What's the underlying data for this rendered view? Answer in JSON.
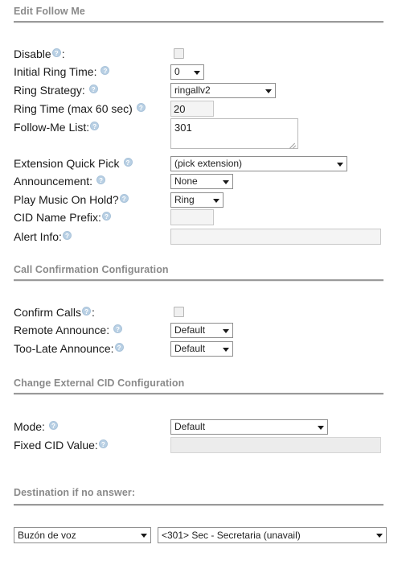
{
  "page": {
    "title": "Edit Follow Me"
  },
  "sections": {
    "main_heading": "Edit Follow Me",
    "call_confirmation": "Call Confirmation Configuration",
    "change_external_cid": "Change External CID Configuration",
    "destination": "Destination if no answer:"
  },
  "help_icon": {
    "name": "help-icon",
    "glyph": "?",
    "color": "#b9d0e4"
  },
  "fields": {
    "disable": {
      "label": "Disable",
      "suffix": ":",
      "checked": false,
      "control": "checkbox"
    },
    "initial_ring_time": {
      "label": "Initial Ring Time:",
      "value": "0",
      "control": "select"
    },
    "ring_strategy": {
      "label": "Ring Strategy:",
      "value": "ringallv2",
      "control": "select"
    },
    "ring_time": {
      "label": "Ring Time (max 60 sec)",
      "value": "20",
      "control": "text"
    },
    "follow_me_list": {
      "label": "Follow-Me List:",
      "value": "301",
      "control": "textarea"
    },
    "extension_quick_pick": {
      "label": "Extension Quick Pick",
      "value": "(pick extension)",
      "control": "select"
    },
    "announcement": {
      "label": "Announcement:",
      "value": "None",
      "control": "select"
    },
    "play_music_on_hold": {
      "label": "Play Music On Hold?",
      "value": "Ring",
      "control": "select"
    },
    "cid_name_prefix": {
      "label": "CID Name Prefix:",
      "value": "",
      "placeholder": "",
      "control": "text"
    },
    "alert_info": {
      "label": "Alert Info:",
      "value": "",
      "placeholder": "",
      "control": "text"
    },
    "confirm_calls": {
      "label": "Confirm Calls",
      "suffix": ":",
      "checked": false,
      "control": "checkbox"
    },
    "remote_announce": {
      "label": "Remote Announce:",
      "value": "Default",
      "control": "select"
    },
    "too_late_announce": {
      "label": "Too-Late Announce:",
      "value": "Default",
      "control": "select"
    },
    "mode": {
      "label": "Mode:",
      "value": "Default",
      "control": "select"
    },
    "fixed_cid_value": {
      "label": "Fixed CID Value:",
      "value": "",
      "placeholder": "",
      "control": "text"
    },
    "destination_type": {
      "value": "Buzón de voz",
      "control": "select"
    },
    "destination_target": {
      "value": "<301> Sec - Secretaria (unavail)",
      "control": "select"
    }
  }
}
